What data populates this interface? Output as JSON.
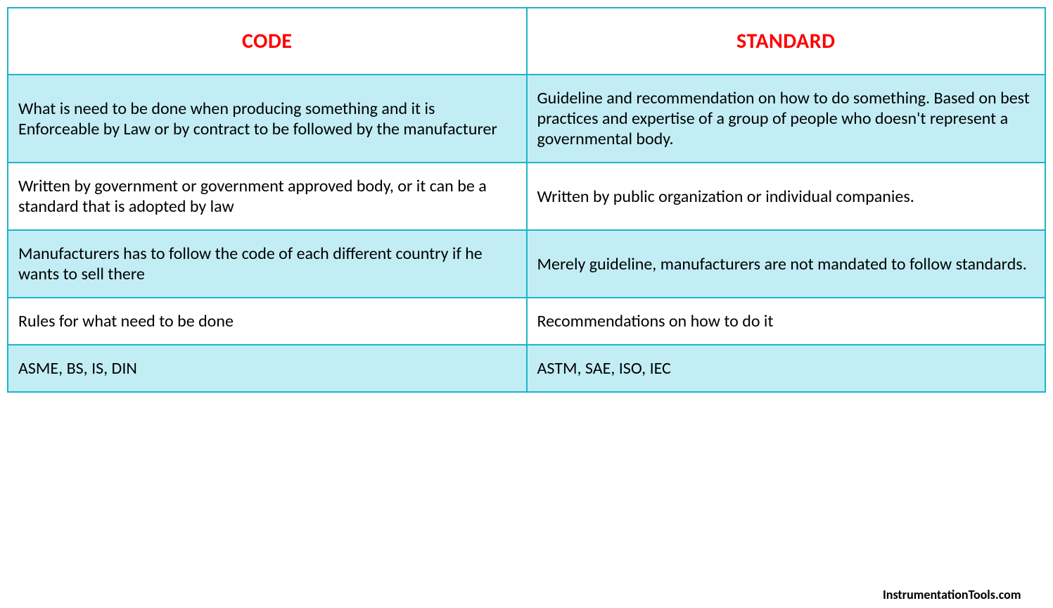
{
  "table": {
    "headers": {
      "col1": "CODE",
      "col2": "STANDARD"
    },
    "rows": [
      {
        "col1": "What is need to be done when producing something and it is Enforceable by Law or by contract to be followed by the manufacturer",
        "col2": "Guideline and recommendation on how to do something. Based on best practices and expertise of a group of people who doesn't represent a governmental body."
      },
      {
        "col1": "Written by government or   government approved body, or it can be a standard that is adopted by law",
        "col2": "Written by public organization or individual companies."
      },
      {
        "col1": "Manufacturers has to follow the code of each different country if he wants to sell there",
        "col2": "Merely guideline, manufacturers are not mandated to follow standards."
      },
      {
        "col1": "Rules for what need to be done",
        "col2": "Recommendations on how to do it"
      },
      {
        "col1": "ASME, BS, IS, DIN",
        "col2": "ASTM, SAE, ISO, IEC"
      }
    ]
  },
  "watermark": "InstrumentationTools.com"
}
